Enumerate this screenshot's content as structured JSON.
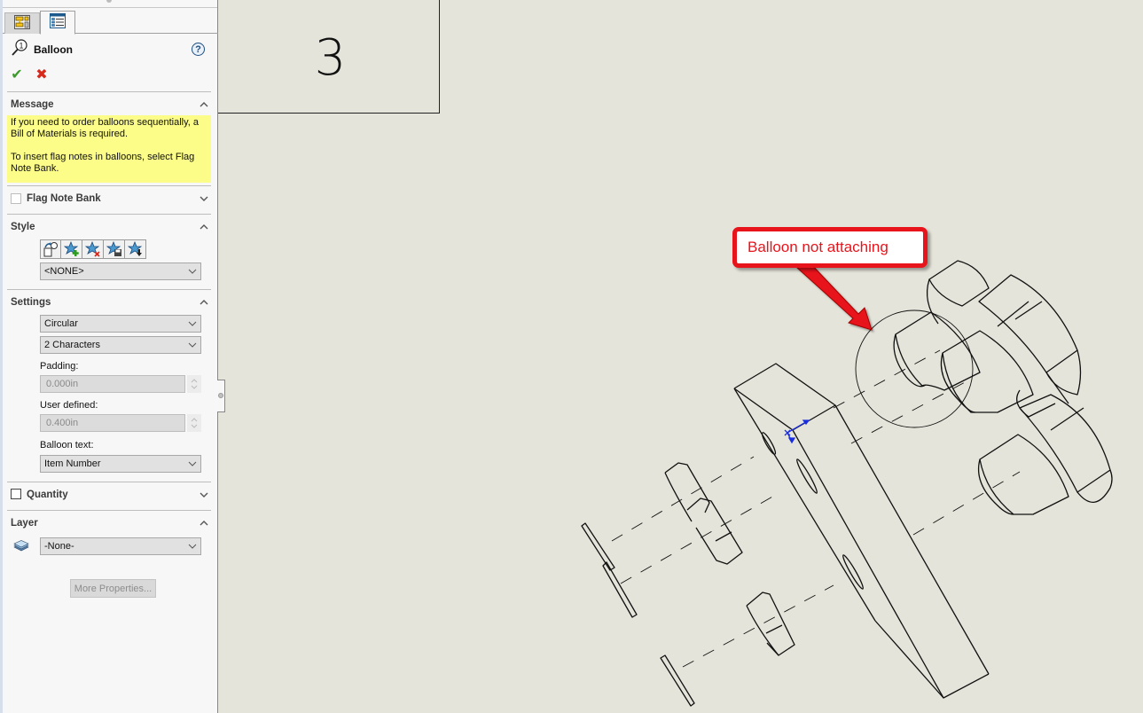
{
  "property_manager": {
    "tabs": [
      {
        "name": "PropertyManager",
        "icon": "property-manager-icon",
        "active": false
      },
      {
        "name": "Configuration",
        "icon": "feature-list-icon",
        "active": true
      }
    ],
    "title": "Balloon",
    "help_icon": "?",
    "ok_icon": "✔",
    "cancel_icon": "✖",
    "message": {
      "header": "Message",
      "lines": [
        "If you need to order balloons sequentially, a Bill of Materials is required.",
        "To insert flag notes in balloons, select Flag Note Bank."
      ]
    },
    "flag_note_bank": {
      "label": "Flag Note Bank",
      "checked": false
    },
    "style": {
      "header": "Style",
      "icons": [
        "apply-default-style-icon",
        "add-style-icon",
        "delete-style-icon",
        "save-style-icon",
        "load-style-icon"
      ],
      "selected": "<NONE>"
    },
    "settings": {
      "header": "Settings",
      "shape": "Circular",
      "size": "2 Characters",
      "padding_label": "Padding:",
      "padding_value": "0.000in",
      "user_defined_label": "User defined:",
      "user_defined_value": "0.400in",
      "balloon_text_label": "Balloon text:",
      "balloon_text_value": "Item Number"
    },
    "quantity": {
      "label": "Quantity",
      "checked": false
    },
    "layer": {
      "header": "Layer",
      "selected": "-None-"
    },
    "more_properties": "More Properties..."
  },
  "drawing": {
    "title_block_value": "3",
    "callout_text": "Balloon not attaching",
    "callout_color": "#e8141c",
    "background_color": "#e5e4da"
  }
}
